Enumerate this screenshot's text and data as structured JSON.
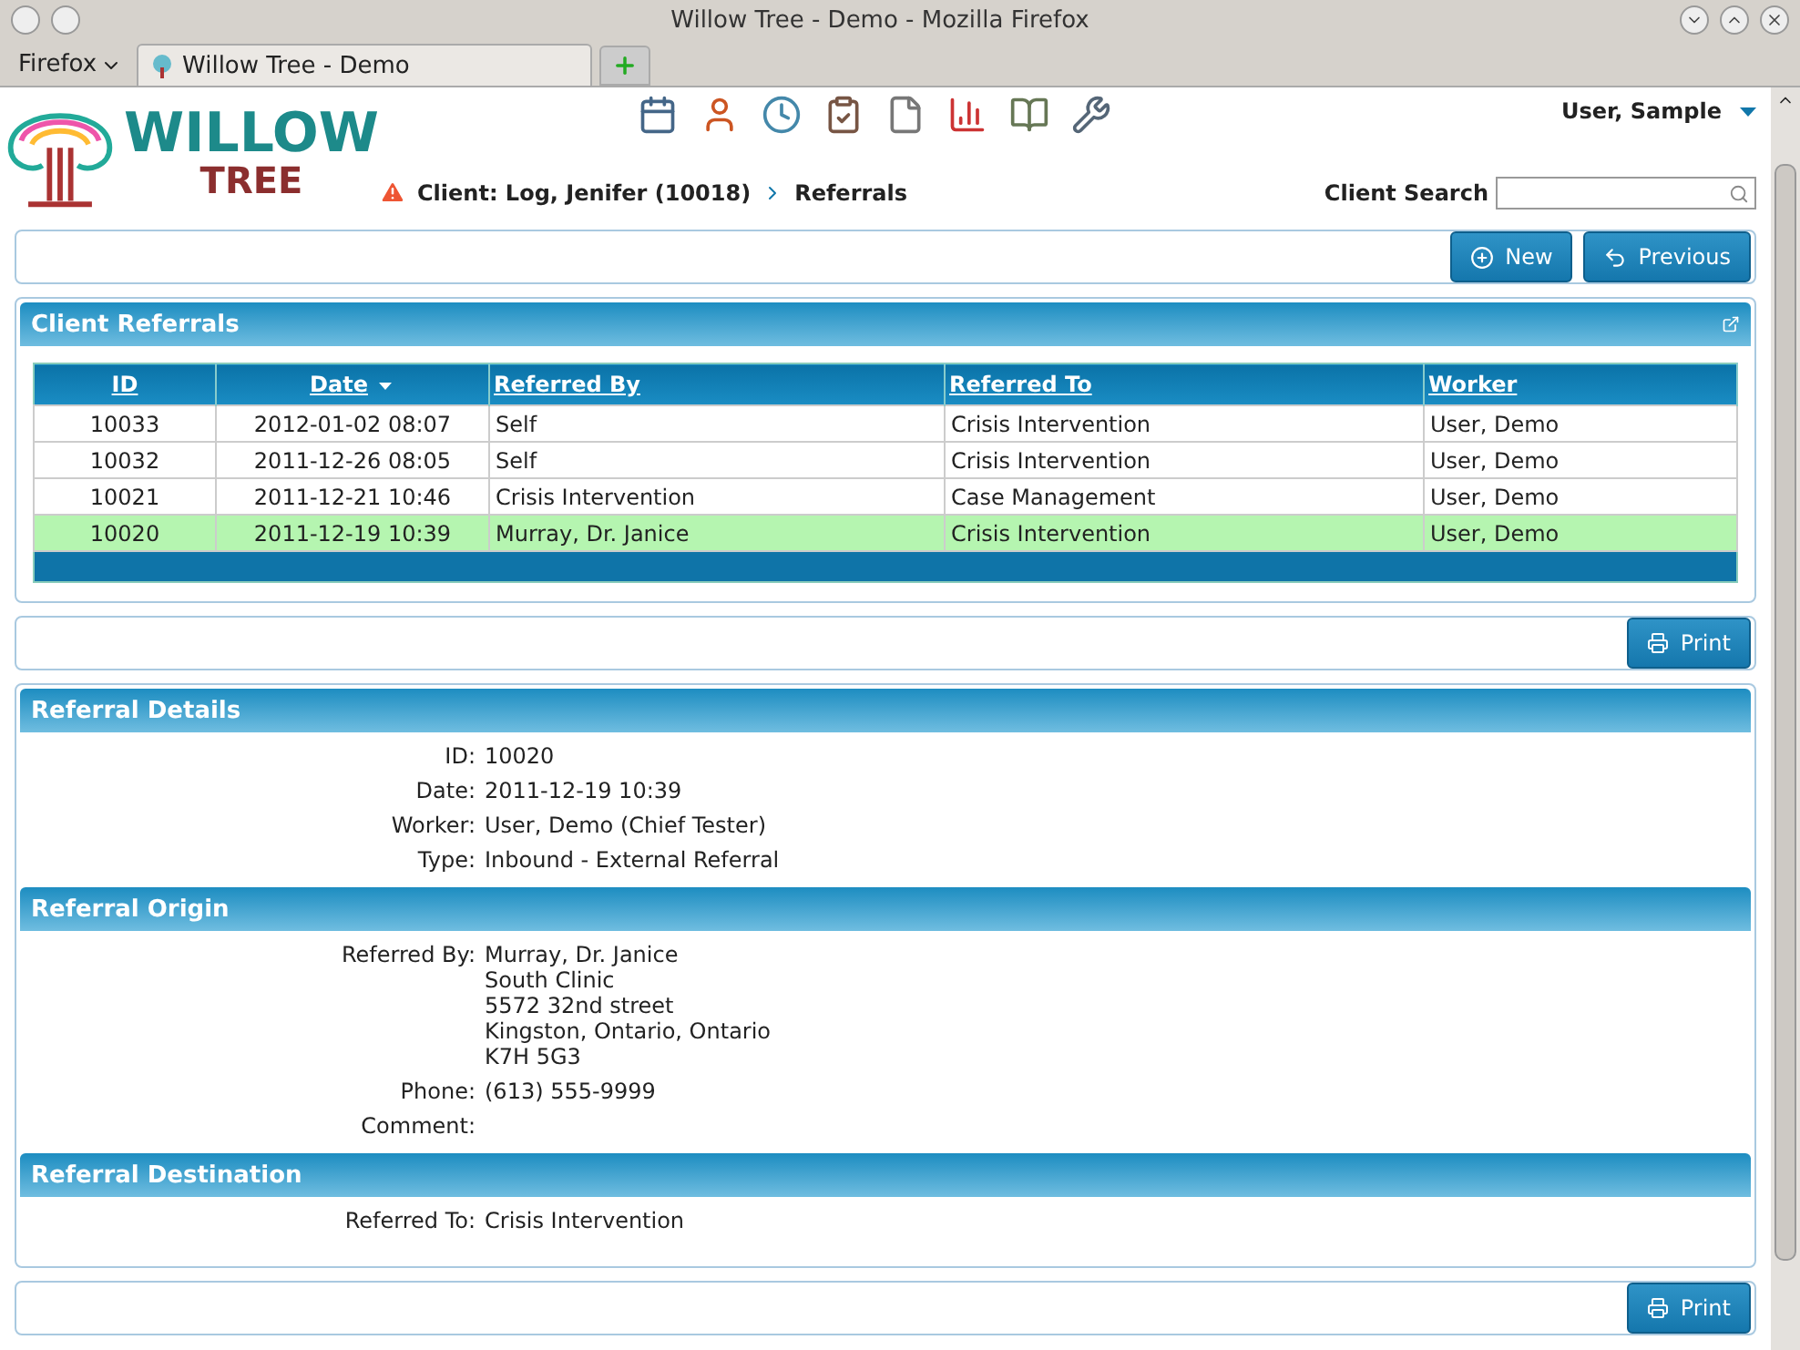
{
  "window": {
    "title": "Willow Tree - Demo - Mozilla Firefox"
  },
  "browser": {
    "menu": "Firefox",
    "tabs": [
      {
        "label": "Willow Tree - Demo",
        "selected": true
      }
    ]
  },
  "logo": {
    "line_1": "WILLOW",
    "line_2": "TREE"
  },
  "user_menu": {
    "label": "User, Sample"
  },
  "breadcrumb": {
    "client": "Client: Log, Jenifer (10018)",
    "page": "Referrals"
  },
  "client_search": {
    "label": "Client Search"
  },
  "top_actions": [
    {
      "label": "New",
      "kind": "add"
    },
    {
      "label": "Previous",
      "kind": "back"
    }
  ],
  "referrals_panel": {
    "title": "Client Referrals",
    "columns": [
      {
        "label": "ID",
        "sorted": false
      },
      {
        "label": "Date",
        "sorted": true
      },
      {
        "label": "Referred By",
        "sorted": false
      },
      {
        "label": "Referred To",
        "sorted": false
      },
      {
        "label": "Worker",
        "sorted": false
      }
    ],
    "rows": [
      {
        "cells": [
          "10033",
          "2012-01-02 08:07",
          "Self",
          "Crisis Intervention",
          "User, Demo"
        ],
        "selected": false
      },
      {
        "cells": [
          "10032",
          "2011-12-26 08:05",
          "Self",
          "Crisis Intervention",
          "User, Demo"
        ],
        "selected": false
      },
      {
        "cells": [
          "10021",
          "2011-12-21 10:46",
          "Crisis Intervention",
          "Case Management",
          "User, Demo"
        ],
        "selected": false
      },
      {
        "cells": [
          "10020",
          "2011-12-19 10:39",
          "Murray, Dr. Janice",
          "Crisis Intervention",
          "User, Demo"
        ],
        "selected": true
      }
    ]
  },
  "print_buttons": [
    {
      "label": "Print"
    },
    {
      "label": "Print"
    }
  ],
  "detail_sections": [
    {
      "title": "Referral Details",
      "fields": [
        {
          "label": "ID:",
          "lines": [
            "10020"
          ]
        },
        {
          "label": "Date:",
          "lines": [
            "2011-12-19 10:39"
          ]
        },
        {
          "label": "Worker:",
          "lines": [
            "User, Demo (Chief Tester)"
          ]
        },
        {
          "label": "Type:",
          "lines": [
            "Inbound - External Referral"
          ]
        }
      ]
    },
    {
      "title": "Referral Origin",
      "fields": [
        {
          "label": "Referred By:",
          "lines": [
            "Murray, Dr. Janice",
            "South Clinic",
            "5572 32nd street",
            "Kingston, Ontario, Ontario",
            "K7H 5G3"
          ]
        },
        {
          "label": "Phone:",
          "lines": [
            "(613) 555-9999"
          ]
        },
        {
          "label": "Comment:"
        }
      ]
    },
    {
      "title": "Referral Destination",
      "fields": [
        {
          "label": "Referred To:",
          "lines": [
            "Crisis Intervention"
          ]
        }
      ]
    }
  ]
}
